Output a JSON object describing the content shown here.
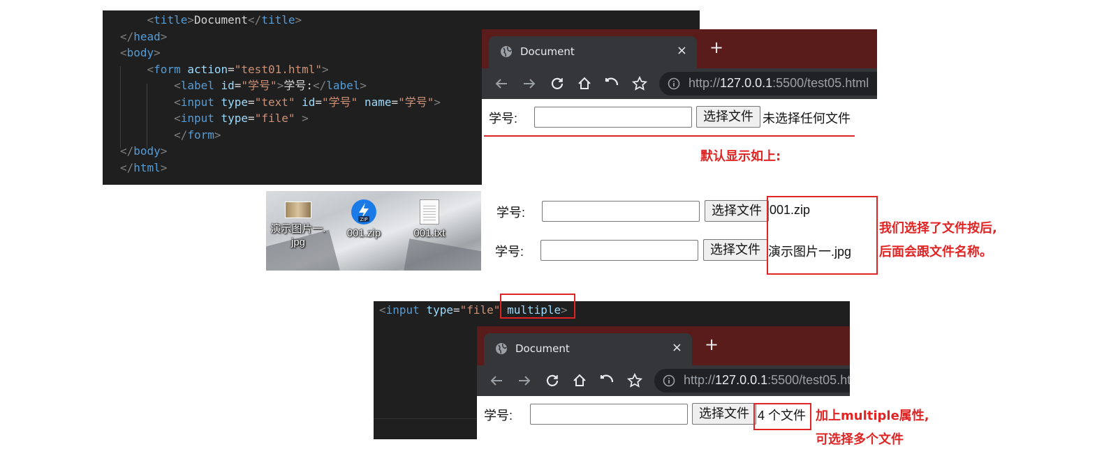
{
  "top_editor": {
    "lines": [
      {
        "indent": "    ",
        "tokens": [
          [
            "br",
            "<"
          ],
          [
            "t",
            "title"
          ],
          [
            "br",
            ">"
          ],
          [
            "tx",
            "Document"
          ],
          [
            "br",
            "</"
          ],
          [
            "t",
            "title"
          ],
          [
            "br",
            ">"
          ]
        ]
      },
      {
        "indent": "",
        "tokens": [
          [
            "br",
            "</"
          ],
          [
            "t",
            "head"
          ],
          [
            "br",
            ">"
          ]
        ]
      },
      {
        "indent": "",
        "tokens": [
          [
            "br",
            "<"
          ],
          [
            "t",
            "body"
          ],
          [
            "br",
            ">"
          ]
        ]
      },
      {
        "indent": "    ",
        "tokens": [
          [
            "br",
            "<"
          ],
          [
            "t",
            "form"
          ],
          [
            "tx",
            " "
          ],
          [
            "a",
            "action"
          ],
          [
            "tx",
            "="
          ],
          [
            "s",
            "\"test01.html\""
          ],
          [
            "br",
            ">"
          ]
        ]
      },
      {
        "indent": "        ",
        "tokens": [
          [
            "br",
            "<"
          ],
          [
            "t",
            "label"
          ],
          [
            "tx",
            " "
          ],
          [
            "a",
            "id"
          ],
          [
            "tx",
            "="
          ],
          [
            "s",
            "\"学号\""
          ],
          [
            "br",
            ">"
          ],
          [
            "tx",
            "学号:"
          ],
          [
            "br",
            "</"
          ],
          [
            "t",
            "label"
          ],
          [
            "br",
            ">"
          ]
        ]
      },
      {
        "indent": "        ",
        "tokens": [
          [
            "br",
            "<"
          ],
          [
            "t",
            "input"
          ],
          [
            "tx",
            " "
          ],
          [
            "a",
            "type"
          ],
          [
            "tx",
            "="
          ],
          [
            "s",
            "\"text\""
          ],
          [
            "tx",
            " "
          ],
          [
            "a",
            "id"
          ],
          [
            "tx",
            "="
          ],
          [
            "s",
            "\"学号\""
          ],
          [
            "tx",
            " "
          ],
          [
            "a",
            "name"
          ],
          [
            "tx",
            "="
          ],
          [
            "s",
            "\"学号\""
          ],
          [
            "br",
            ">"
          ]
        ]
      },
      {
        "indent": "        ",
        "tokens": [
          [
            "br",
            "<"
          ],
          [
            "t",
            "input"
          ],
          [
            "tx",
            " "
          ],
          [
            "a",
            "type"
          ],
          [
            "tx",
            "="
          ],
          [
            "s",
            "\"file\""
          ],
          [
            "tx",
            " "
          ],
          [
            "br",
            ">"
          ]
        ]
      },
      {
        "indent": "        ",
        "tokens": [
          [
            "br",
            "</"
          ],
          [
            "t",
            "form"
          ],
          [
            "br",
            ">"
          ]
        ]
      },
      {
        "indent": "",
        "tokens": [
          [
            "br",
            "</"
          ],
          [
            "t",
            "body"
          ],
          [
            "br",
            ">"
          ]
        ]
      },
      {
        "indent": "",
        "tokens": [
          [
            "br",
            "</"
          ],
          [
            "t",
            "html"
          ],
          [
            "br",
            ">"
          ]
        ]
      }
    ]
  },
  "bottom_editor": {
    "lines": [
      {
        "indent": "",
        "tokens": [
          [
            "br",
            "<"
          ],
          [
            "t",
            "input"
          ],
          [
            "tx",
            " "
          ],
          [
            "a",
            "type"
          ],
          [
            "tx",
            "="
          ],
          [
            "s",
            "\"file\""
          ],
          [
            "tx",
            " "
          ],
          [
            "a",
            "multiple"
          ],
          [
            "br",
            ">"
          ]
        ]
      }
    ]
  },
  "browser": {
    "tab_title": "Document",
    "tab_close": "×",
    "new_tab": "+",
    "url_prefix": "http://",
    "url_host": "127.0.0.1",
    "url_suffix": ":5500/test05.html"
  },
  "form": {
    "label": "学号:",
    "file_button": "选择文件",
    "status_default": "未选择任何文件",
    "status_zip": "001.zip",
    "status_jpg": "演示图片一.jpg",
    "status_multiple": "4 个文件"
  },
  "desktop_icons": [
    {
      "name": "演示图片一.jpg",
      "line1": "演示图片一.",
      "line2": "jpg"
    },
    {
      "name": "001.zip",
      "line1": "001.zip",
      "line2": ""
    },
    {
      "name": "001.txt",
      "line1": "001.txt",
      "line2": ""
    }
  ],
  "annotations": {
    "default_shown": "默认显示如上:",
    "after_select_1": "我们选择了文件按后,",
    "after_select_2": "后面会跟文件名称。",
    "multiple_1": "加上multiple属性,",
    "multiple_2": "可选择多个文件"
  },
  "colors": {
    "editor_bg": "#1f1f1f",
    "tab_strip": "#5a1b1b",
    "chrome_dark": "#35363a",
    "annotation_red": "#e02424"
  }
}
